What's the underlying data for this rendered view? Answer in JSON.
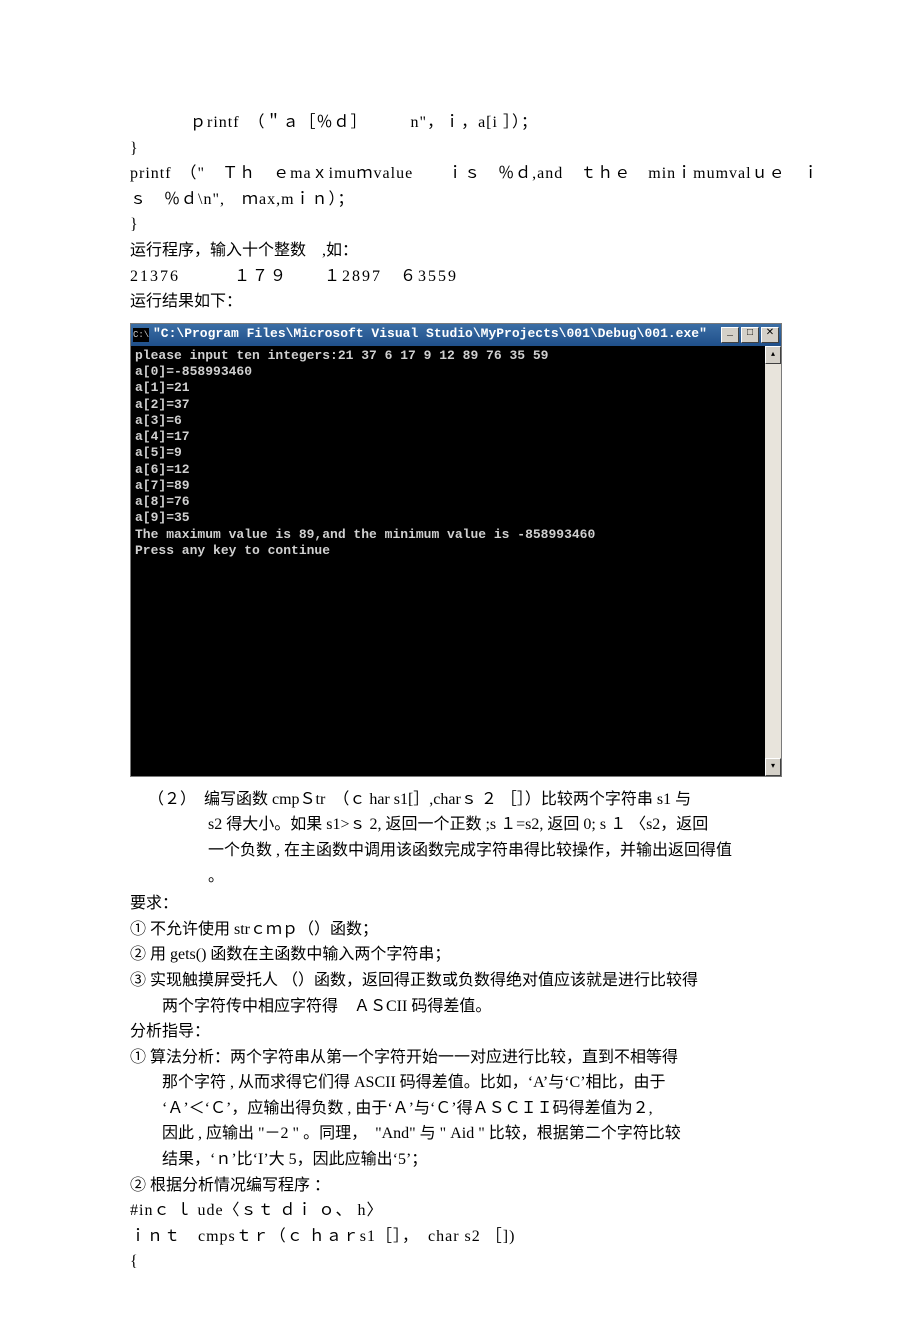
{
  "code_top": {
    "l1": "ｐrintf　（＂ａ［％ｄ］　　　n\"，ｉ，a[i ］）；",
    "l2": "}",
    "l3": "printf　（\"　Ｔｈ　ｅmaｘimuｍvalue　　ｉｓ　％ｄ,and　ｔｈｅ　minｉmumvalｕｅ　ｉ",
    "l4": "ｓ　％ｄ\\n\",　ｍax,mｉｎ）；",
    "l5": "}"
  },
  "run1": "运行程序，输入十个整数　,如：",
  "run2": "21376　　　１７９　　１2897　６3559",
  "run3": "运行结果如下：",
  "console": {
    "icon": "C:\\",
    "title": "\"C:\\Program Files\\Microsoft Visual Studio\\MyProjects\\001\\Debug\\001.exe\"",
    "lines": [
      "please input ten integers:21 37 6 17 9 12 89 76 35 59",
      "a[0]=-858993460",
      "a[1]=21",
      "a[2]=37",
      "a[3]=6",
      "a[4]=17",
      "a[5]=9",
      "a[6]=12",
      "a[7]=89",
      "a[8]=76",
      "a[9]=35",
      "The maximum value is 89,and the minimum value is -858993460",
      "Press any key to continue"
    ],
    "btn_min": "_",
    "btn_max": "□",
    "btn_close": "✕",
    "sb_up": "▴",
    "sb_down": "▾"
  },
  "q2": {
    "l1": "（２）　编写函数 cmpＳtr　（ｃ har s1[］,charｓ ２ ［］）比较两个字符串  s1 与",
    "l2": "s2 得大小。如果 s1>ｓ 2, 返回一个正数 ;s １=s2, 返回 0;  s １ 〈s2，返回",
    "l3": "一个负数 , 在主函数中调用该函数完成字符串得比较操作，并输出返回得值",
    "l4": "。"
  },
  "req_label": "要求：",
  "req1": "① 不允许使用 strｃｍｐ（）函数；",
  "req2": "② 用 gets() 函数在主函数中输入两个字符串；",
  "req3a": "③ 实现触摸屏受托人 （）函数，返回得正数或负数得绝对值应该就是进行比较得",
  "req3b": "两个字符传中相应字符得　ＡＳCII 码得差值。",
  "ana_label": "分析指导：",
  "ana1a": "① 算法分析：两个字符串从第一个字符开始一一对应进行比较，直到不相等得",
  "ana1b": "那个字符 , 从而求得它们得  ASCII 码得差值。比如，‘A’与‘C’相比，由于",
  "ana1c": "‘Ａ’＜‘Ｃ’，应输出得负数 , 由于‘Ａ’与‘Ｃ’得ＡＳＣＩＩ码得差值为２,",
  "ana1d": "因此 , 应输出 \"－2 \" 。同理，　\"And\" 与 \" Aid \" 比较，根据第二个字符比较",
  "ana1e": "结果，‘ｎ’比‘I’大 5，因此应输出‘5’；",
  "ana2": "② 根据分析情况编写程序 ：",
  "code_bottom": {
    "l1": "#inｃ ｌ ude〈ｓｔ ｄｉ ｏ、 h〉",
    "l2": "ｉｎｔ　cmpsｔｒ（ｃ ｈａｒs1［］，　char s2 ［])",
    "l3": "{"
  }
}
